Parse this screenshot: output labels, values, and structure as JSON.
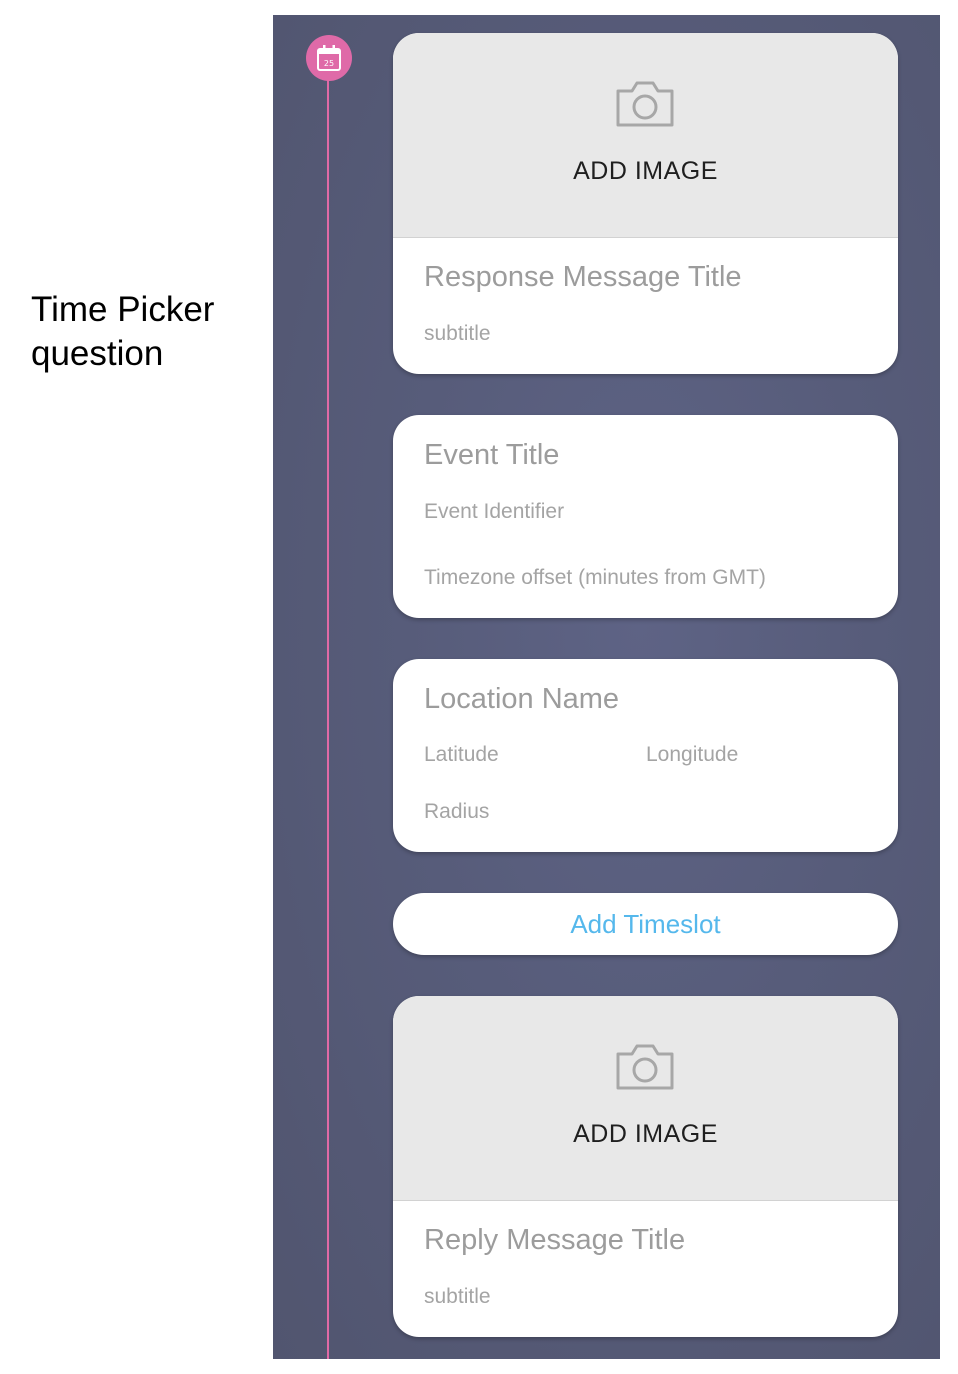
{
  "caption": {
    "line1": "Time Picker",
    "line2": "question"
  },
  "timeline": {
    "icon": "calendar-icon",
    "calendar_day": "25",
    "accent_color": "#df6aa8"
  },
  "response_card": {
    "add_image_label": "ADD IMAGE",
    "title_placeholder": "Response Message Title",
    "subtitle_placeholder": "subtitle"
  },
  "event_card": {
    "title_placeholder": "Event Title",
    "identifier_placeholder": "Event Identifier",
    "timezone_placeholder": "Timezone offset (minutes from GMT)"
  },
  "location_card": {
    "name_placeholder": "Location Name",
    "latitude_placeholder": "Latitude",
    "longitude_placeholder": "Longitude",
    "radius_placeholder": "Radius"
  },
  "add_timeslot_label": "Add Timeslot",
  "reply_card": {
    "add_image_label": "ADD IMAGE",
    "title_placeholder": "Reply Message Title",
    "subtitle_placeholder": "subtitle"
  }
}
